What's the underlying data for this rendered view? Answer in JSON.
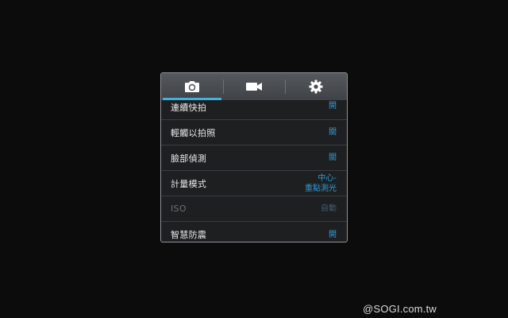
{
  "tabs": [
    {
      "icon": "camera-icon",
      "active": true
    },
    {
      "icon": "video-camera-icon",
      "active": false
    },
    {
      "icon": "gear-icon",
      "active": false
    }
  ],
  "settings": [
    {
      "label": "連續快拍",
      "value": "開"
    },
    {
      "label": "輕觸以拍照",
      "value": "關"
    },
    {
      "label": "臉部偵測",
      "value": "關"
    },
    {
      "label": "計量模式",
      "value_line1": "中心-",
      "value_line2": "重點測光"
    },
    {
      "label": "ISO",
      "value": "自動",
      "disabled": true
    },
    {
      "label": "智慧防震",
      "value": "開"
    }
  ],
  "colors": {
    "accent": "#3fb2e2",
    "value_text": "#2f9bd8",
    "panel_bg": "#1e1f21"
  },
  "watermark": "@SOGI.com.tw"
}
